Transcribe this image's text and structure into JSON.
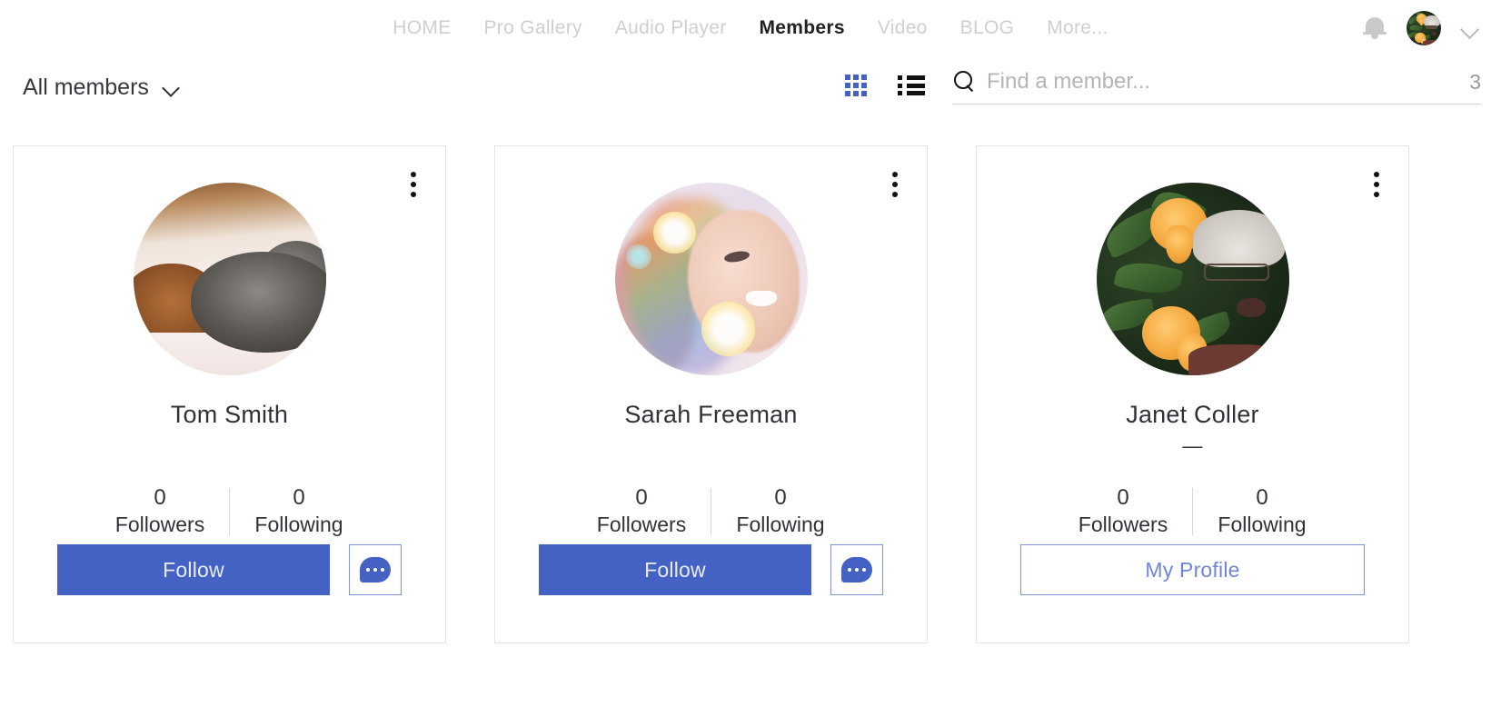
{
  "header": {
    "nav": [
      {
        "label": "HOME",
        "active": false
      },
      {
        "label": "Pro Gallery",
        "active": false
      },
      {
        "label": "Audio Player",
        "active": false
      },
      {
        "label": "Members",
        "active": true
      },
      {
        "label": "Video",
        "active": false
      },
      {
        "label": "BLOG",
        "active": false
      },
      {
        "label": "More...",
        "active": false
      }
    ],
    "notifications_icon": "bell-icon",
    "account_chevron_icon": "chevron-down-icon",
    "account_avatar_alt": "Janet Coller avatar"
  },
  "toolbar": {
    "filter_label": "All members",
    "filter_chevron_icon": "chevron-down-icon",
    "grid_view_icon": "grid-view-icon",
    "list_view_icon": "list-view-icon",
    "active_view": "grid",
    "search_icon": "search-icon",
    "search_value": "",
    "search_placeholder": "Find a member...",
    "member_count": "3"
  },
  "colors": {
    "accent_blue": "#4462c4",
    "outline_blue": "#8093d9",
    "profile_text_blue": "#6f86d6",
    "nav_inactive": "#cfcfcf",
    "nav_active": "#222222"
  },
  "members": [
    {
      "name": "Tom Smith",
      "subtitle": "",
      "avatar_style": "ph-puppies",
      "avatar_alt": "sleeping puppies photo",
      "followers_count": "0",
      "followers_label": "Followers",
      "following_count": "0",
      "following_label": "Following",
      "primary_action": "Follow",
      "primary_action_type": "follow",
      "has_message_button": true,
      "menu_icon": "more-vertical-icon"
    },
    {
      "name": "Sarah Freeman",
      "subtitle": "",
      "avatar_style": "ph-rainbow",
      "avatar_alt": "woman smiling with rainbow bokeh light",
      "followers_count": "0",
      "followers_label": "Followers",
      "following_count": "0",
      "following_label": "Following",
      "primary_action": "Follow",
      "primary_action_type": "follow",
      "has_message_button": true,
      "menu_icon": "more-vertical-icon"
    },
    {
      "name": "Janet Coller",
      "subtitle": "—",
      "avatar_style": "ph-flowers",
      "avatar_alt": "elderly woman with orange flowers",
      "followers_count": "0",
      "followers_label": "Followers",
      "following_count": "0",
      "following_label": "Following",
      "primary_action": "My Profile",
      "primary_action_type": "profile",
      "has_message_button": false,
      "menu_icon": "more-vertical-icon"
    }
  ]
}
